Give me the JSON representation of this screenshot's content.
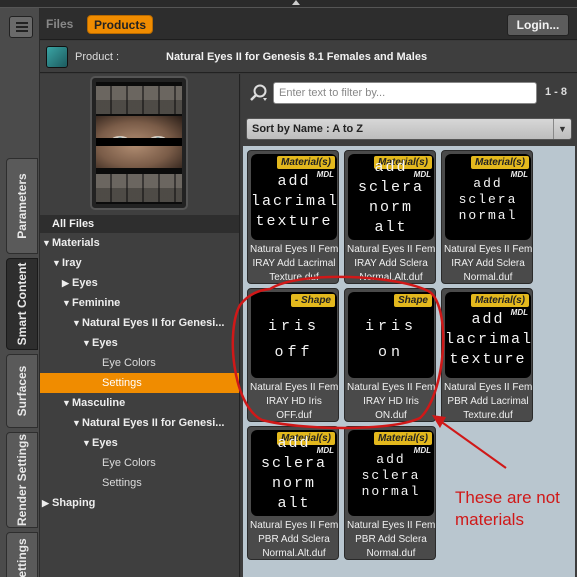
{
  "header": {
    "tab_files": "Files",
    "tab_products": "Products",
    "login": "Login..."
  },
  "left_tabs": [
    {
      "label": "Parameters"
    },
    {
      "label": "Smart Content"
    },
    {
      "label": "Surfaces"
    },
    {
      "label": "Render Settings"
    },
    {
      "label": "ettings"
    }
  ],
  "product": {
    "label": "Product :",
    "name": "Natural Eyes II for Genesis 8.1 Females and Males"
  },
  "tree": {
    "header": "All Files",
    "rows": [
      {
        "label": "Materials"
      },
      {
        "label": "Iray"
      },
      {
        "label": "Eyes"
      },
      {
        "label": "Feminine"
      },
      {
        "label": "Natural Eyes II for Genesi..."
      },
      {
        "label": "Eyes"
      },
      {
        "label": "Eye Colors"
      },
      {
        "label": "Settings"
      },
      {
        "label": "Masculine"
      },
      {
        "label": "Natural Eyes II for Genesi..."
      },
      {
        "label": "Eyes"
      },
      {
        "label": "Eye Colors"
      },
      {
        "label": "Settings"
      },
      {
        "label": "Shaping"
      }
    ]
  },
  "content": {
    "search_placeholder": "Enter text to filter by...",
    "range": "1 - 8",
    "sort": "Sort by Name : A to Z"
  },
  "cards": [
    {
      "badge": "Material(s)",
      "mdl": "MDL",
      "art": "add\nlacrimal\ntexture",
      "caption": "Natural Eyes II Fem\nIRAY Add Lacrimal\nTexture.duf"
    },
    {
      "badge": "Material(s)",
      "mdl": "MDL",
      "art": "add\nsclera\nnorm\nalt",
      "caption": "Natural Eyes II Fem\nIRAY Add Sclera\nNormal.Alt.duf"
    },
    {
      "badge": "Material(s)",
      "mdl": "MDL",
      "art": "add\nsclera\nnormal",
      "caption": "Natural Eyes II Fem\nIRAY Add Sclera\nNormal.duf"
    },
    {
      "badge": "- Shape",
      "mdl": "",
      "art": "iris\noff",
      "caption": "Natural Eyes II Fem\nIRAY HD Iris\nOFF.duf"
    },
    {
      "badge": "Shape",
      "mdl": "",
      "art": "iris\non",
      "caption": "Natural Eyes II Fem\nIRAY HD Iris\nON.duf"
    },
    {
      "badge": "Material(s)",
      "mdl": "MDL",
      "art": "add\nlacrimal\ntexture",
      "caption": "Natural Eyes II Fem\nPBR Add Lacrimal\nTexture.duf"
    },
    {
      "badge": "Material(s)",
      "mdl": "MDL",
      "art": "add\nsclera\nnorm\nalt",
      "caption": "Natural Eyes II Fem\nPBR Add Sclera\nNormal.Alt.duf"
    },
    {
      "badge": "Material(s)",
      "mdl": "MDL",
      "art": "add\nsclera\nnormal",
      "caption": "Natural Eyes II Fem\nPBR Add Sclera\nNormal.duf"
    }
  ],
  "annotation": {
    "text": "These are not\nmaterials",
    "color": "#d01818"
  },
  "colors": {
    "accent": "#f08c00",
    "badge": "#e3b81d",
    "grid_bg": "#b9c6cf"
  }
}
